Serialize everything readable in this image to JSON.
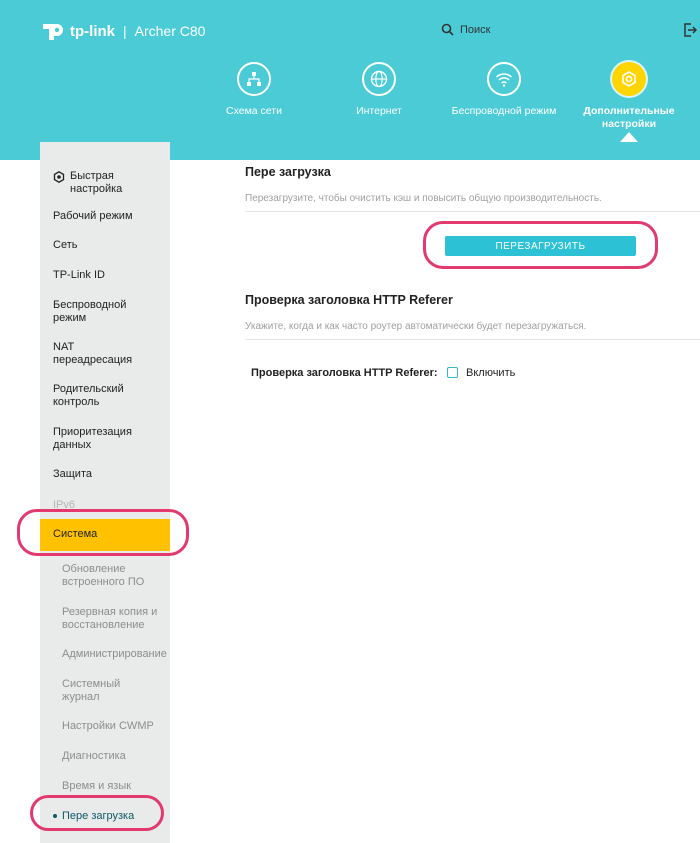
{
  "header": {
    "brand": "tp-link",
    "separator": "|",
    "model": "Archer C80",
    "search_label": "Поиск"
  },
  "nav": [
    {
      "label": "Схема сети",
      "icon": "network-map-icon"
    },
    {
      "label": "Интернет",
      "icon": "globe-icon"
    },
    {
      "label": "Беспроводной режим",
      "icon": "wifi-icon"
    },
    {
      "label": "Дополнительные настройки",
      "icon": "advanced-settings-icon",
      "active": true
    }
  ],
  "sidebar": {
    "items": [
      "Быстрая настройка",
      "Рабочий режим",
      "Сеть",
      "TP-Link ID",
      "Беспроводной режим",
      "NAT переадресация",
      "Родительский контроль",
      "Приоритезация данных",
      "Защита",
      "IPv6",
      "Система"
    ],
    "subitems": [
      "Обновление встроенного ПО",
      "Резервная копия и восстановление",
      "Администрирование",
      "Системный журнал",
      "Настройки CWMP",
      "Диагностика",
      "Время и язык",
      "Пере загрузка"
    ],
    "active_item": "Система",
    "active_subitem": "Пере загрузка"
  },
  "main": {
    "reboot": {
      "title": "Пере загрузка",
      "description": "Перезагрузите, чтобы очистить кэш и повысить общую производительность.",
      "button": "ПЕРЕЗАГРУЗИТЬ"
    },
    "referer": {
      "title": "Проверка заголовка HTTP Referer",
      "description": "Укажите, когда и как часто роутер автоматически будет перезагружаться.",
      "field_label": "Проверка заголовка HTTP Referer:",
      "checkbox_label": "Включить",
      "checked": false
    }
  },
  "colors": {
    "header": "#4acbd6",
    "button": "#2dc1d5",
    "active": "#ffc100",
    "highlight_ring": "#e23a6e"
  }
}
